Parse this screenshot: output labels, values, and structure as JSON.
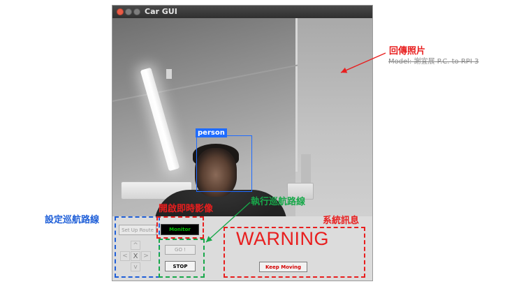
{
  "window": {
    "title": "Car GUI"
  },
  "camera": {
    "detection_label": "person"
  },
  "controls": {
    "setup_route_label": "Set Up Route",
    "monitor_label": "Monitor",
    "go_label": "GO !",
    "stop_label": "STOP",
    "dpad": {
      "up": "^",
      "left": "<",
      "center": "X",
      "right": ">",
      "down": "v"
    },
    "warning_text": "WARNING",
    "keep_moving_label": "Keep Moving"
  },
  "annotations": {
    "return_photo": "回傳照片",
    "model_note": "Model: 謝宜展 P.C. to RPI 3",
    "setup_route": "設定巡航路線",
    "open_live_video": "開啟即時影像",
    "execute_route": "執行巡航路線",
    "system_message": "系統訊息"
  },
  "colors": {
    "annotation_red": "#e81e1e",
    "annotation_blue": "#1f5fd8",
    "annotation_green": "#18a84a",
    "detection_blue": "#1e6bff",
    "monitor_text": "#00c400"
  }
}
